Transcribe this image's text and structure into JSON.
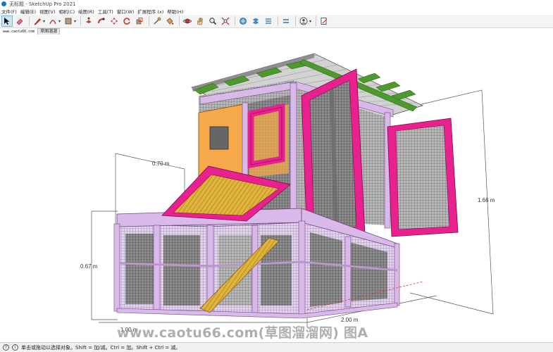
{
  "window": {
    "title": "无标题 - SketchUp Pro 2021"
  },
  "menu": [
    "文件(F)",
    "编辑(E)",
    "视图(V)",
    "相机(C)",
    "绘图(R)",
    "工具(T)",
    "窗口(W)",
    "扩展程序 (x)",
    "帮助(H)"
  ],
  "toolbar": {
    "tools": [
      "select",
      "eraser",
      "line",
      "arc",
      "rectangle",
      "push-pull",
      "follow-me",
      "move",
      "rotate",
      "scale",
      "offset",
      "tape-measure",
      "dimension",
      "protractor",
      "text",
      "axes",
      "3d-text",
      "paint-bucket",
      "orbit",
      "pan",
      "zoom",
      "zoom-extents",
      "section-plane",
      "sandbox",
      "styles",
      "walk",
      "look-around",
      "extension-warehouse",
      "layout"
    ]
  },
  "tabs": {
    "site_tag": "www.caotu66.com",
    "scene": "草图溜溜"
  },
  "model": {
    "dimensions": [
      "0.70 m",
      "1.66 m",
      "0.67 m",
      "2.00 m",
      "1.00 m"
    ],
    "colors": {
      "frame": "#d9b8ea",
      "door": "#e8218f",
      "panel": "#f6a94a",
      "roof_beam": "#4c9a2e",
      "roof_sheet": "#c9c9c9",
      "ramp": "#e0b33a",
      "mesh": "#4a4a4a"
    }
  },
  "status": {
    "text": "单击或拖动以选择对象。Shift = 加/减。Ctrl = 加。Shift + Ctrl = 减。"
  },
  "watermark": {
    "text": "www.caotu66.com(草图溜溜网) 图A"
  }
}
